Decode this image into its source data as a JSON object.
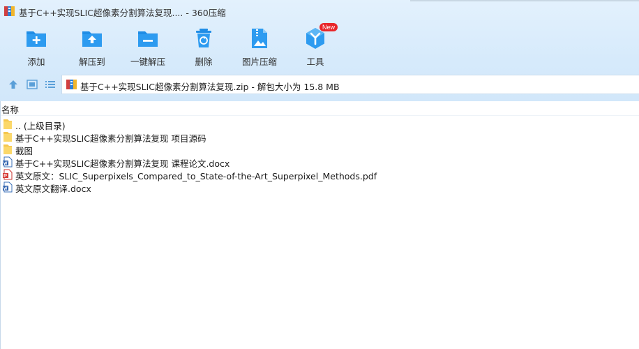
{
  "window": {
    "title": "基于C++实现SLIC超像素分割算法复现.... - 360压缩"
  },
  "toolbar": {
    "items": [
      {
        "label": "添加",
        "icon": "add-icon"
      },
      {
        "label": "解压到",
        "icon": "extract-to-icon"
      },
      {
        "label": "一键解压",
        "icon": "one-click-extract-icon"
      },
      {
        "label": "删除",
        "icon": "delete-icon"
      },
      {
        "label": "图片压缩",
        "icon": "image-compress-icon"
      },
      {
        "label": "工具",
        "icon": "tools-icon",
        "badge": "New"
      }
    ]
  },
  "address": {
    "path": "基于C++实现SLIC超像素分割算法复现.zip - 解包大小为 15.8 MB"
  },
  "list": {
    "column_name": "名称",
    "files": [
      {
        "name": ".. (上级目录)",
        "type": "folder"
      },
      {
        "name": "基于C++实现SLIC超像素分割算法复现 项目源码",
        "type": "folder"
      },
      {
        "name": "截图",
        "type": "folder"
      },
      {
        "name": "基于C++实现SLIC超像素分割算法复现 课程论文.docx",
        "type": "docx"
      },
      {
        "name": "英文原文：SLIC_Superpixels_Compared_to_State-of-the-Art_Superpixel_Methods.pdf",
        "type": "pdf"
      },
      {
        "name": "英文原文翻译.docx",
        "type": "docx"
      }
    ]
  },
  "colors": {
    "accent": "#1f8de6",
    "badge": "#e8262a"
  }
}
